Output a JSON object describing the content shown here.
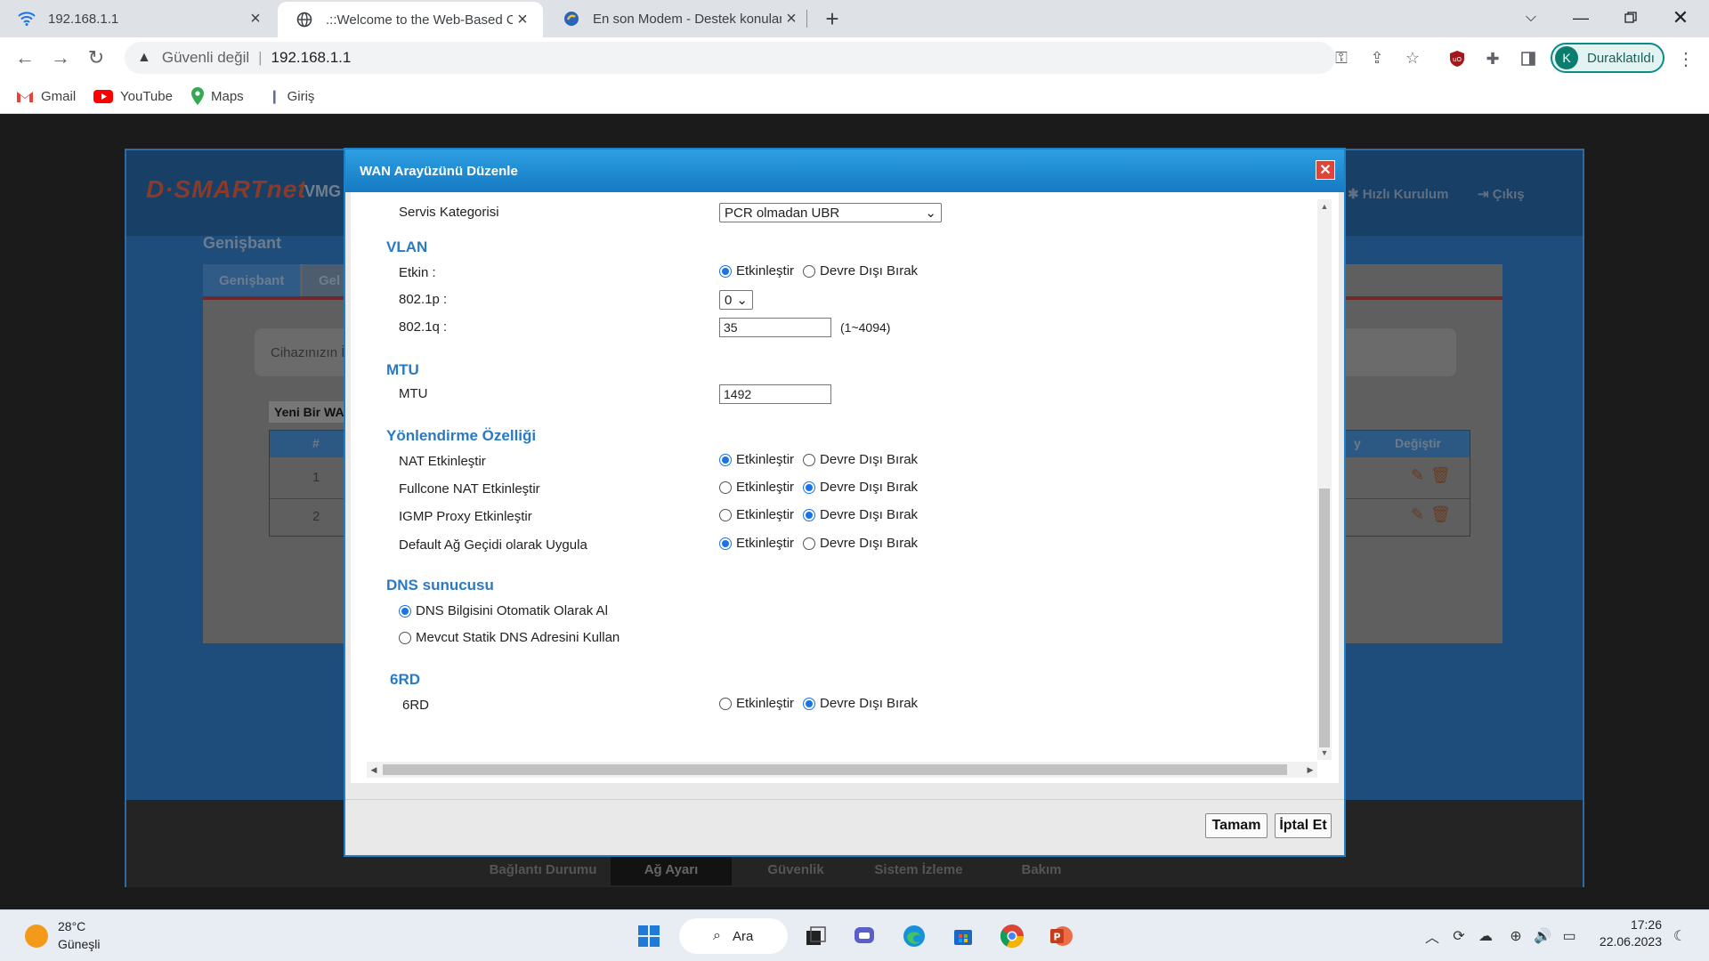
{
  "browser": {
    "tabs": [
      {
        "title": "192.168.1.1",
        "icon": "wifi-icon"
      },
      {
        "title": ".::Welcome to the Web-Based Co",
        "icon": "globe-icon"
      },
      {
        "title": "En son Modem - Destek konular",
        "icon": "forum-icon"
      }
    ],
    "address": {
      "security": "Güvenli değil",
      "url": "192.168.1.1"
    },
    "profile": {
      "initial": "K",
      "label": "Duraklatıldı"
    },
    "bookmarks": [
      {
        "label": "Gmail",
        "icon": "gmail-icon"
      },
      {
        "label": "YouTube",
        "icon": "youtube-icon"
      },
      {
        "label": "Maps",
        "icon": "maps-icon"
      },
      {
        "label": "Giriş",
        "icon": "bookmark-icon"
      }
    ]
  },
  "router": {
    "logo": "D·SMARTnet",
    "model": "VMG",
    "header_links": {
      "quick_setup": "Hızlı Kurulum",
      "logout": "Çıkış"
    },
    "section_title": "Genişbant",
    "tabs": [
      "Genişbant",
      "Gel"
    ],
    "info_text": "Cihazınızın İ",
    "new_wan": "Yeni Bir WA",
    "table": {
      "headers": [
        "#",
        "Değiştir"
      ],
      "header_fragment": "y",
      "rows": [
        "1",
        "2"
      ]
    },
    "footer_nav": [
      "Bağlantı Durumu",
      "Ağ Ayarı",
      "Güvenlik",
      "Sistem İzleme",
      "Bakım"
    ]
  },
  "modal": {
    "title": "WAN Arayüzünü Düzenle",
    "service_category": {
      "label": "Servis Kategorisi",
      "value": "PCR olmadan UBR"
    },
    "vlan": {
      "heading": "VLAN",
      "enabled_label": "Etkin :",
      "p_label": "802.1p :",
      "p_value": "0",
      "q_label": "802.1q :",
      "q_value": "35",
      "q_hint": "(1~4094)"
    },
    "mtu": {
      "heading": "MTU",
      "label": "MTU",
      "value": "1492"
    },
    "routing": {
      "heading": "Yönlendirme Özelliği",
      "rows": [
        {
          "label": "NAT Etkinleştir",
          "enabled": true
        },
        {
          "label": "Fullcone NAT Etkinleştir",
          "enabled": false
        },
        {
          "label": "IGMP Proxy Etkinleştir",
          "enabled": false
        },
        {
          "label": "Default Ağ Geçidi olarak Uygula",
          "enabled": true
        }
      ]
    },
    "dns": {
      "heading": "DNS sunucusu",
      "auto": "DNS Bilgisini Otomatik Olarak Al",
      "static": "Mevcut Statik DNS Adresini Kullan"
    },
    "sixrd": {
      "heading": "6RD",
      "label": "6RD"
    },
    "radio_labels": {
      "enable": "Etkinleştir",
      "disable": "Devre Dışı Bırak"
    },
    "buttons": {
      "ok": "Tamam",
      "cancel": "İptal Et"
    }
  },
  "taskbar": {
    "weather_temp": "28°C",
    "weather_desc": "Güneşli",
    "search": "Ara",
    "time": "17:26",
    "date": "22.06.2023"
  }
}
